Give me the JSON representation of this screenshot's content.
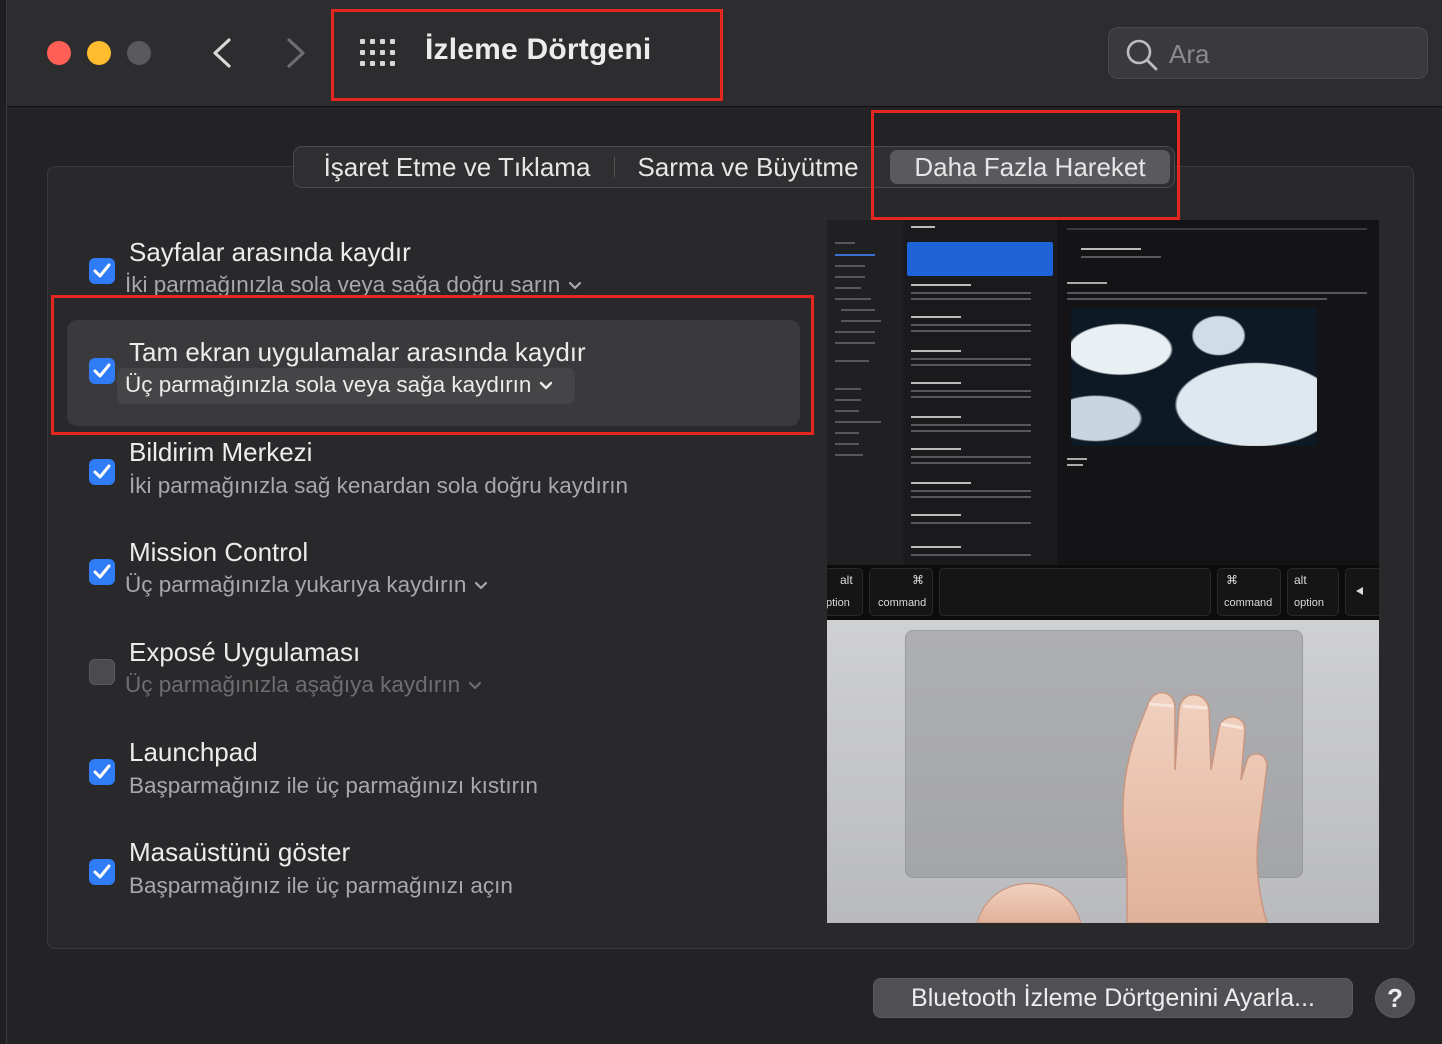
{
  "window": {
    "title": "İzleme Dörtgeni",
    "search_placeholder": "Ara"
  },
  "tabs": [
    {
      "label": "İşaret Etme ve Tıklama",
      "selected": false
    },
    {
      "label": "Sarma ve Büyütme",
      "selected": false
    },
    {
      "label": "Daha Fazla Hareket",
      "selected": true
    }
  ],
  "gestures": [
    {
      "title": "Sayfalar arasında kaydır",
      "subtitle": "İki parmağınızla sola veya sağa doğru sarın",
      "checked": true,
      "has_menu": true
    },
    {
      "title": "Tam ekran uygulamalar arasında kaydır",
      "subtitle": "Üç parmağınızla sola veya sağa kaydırın",
      "checked": true,
      "has_menu": true
    },
    {
      "title": "Bildirim Merkezi",
      "subtitle": "İki parmağınızla sağ kenardan sola doğru kaydırın",
      "checked": true,
      "has_menu": false
    },
    {
      "title": "Mission Control",
      "subtitle": "Üç parmağınızla yukarıya kaydırın",
      "checked": true,
      "has_menu": true
    },
    {
      "title": "Exposé Uygulaması",
      "subtitle": "Üç parmağınızla aşağıya kaydırın",
      "checked": false,
      "has_menu": true
    },
    {
      "title": "Launchpad",
      "subtitle": "Başparmağınız ile üç parmağınızı kıstırın",
      "checked": true,
      "has_menu": false
    },
    {
      "title": "Masaüstünü göster",
      "subtitle": "Başparmağınız ile üç parmağınızı açın",
      "checked": true,
      "has_menu": false
    }
  ],
  "preview": {
    "keys": {
      "left_option": "ption",
      "left_alt": "alt",
      "left_cmd_symbol": "⌘",
      "left_command": "command",
      "right_cmd_symbol": "⌘",
      "right_command": "command",
      "right_alt": "alt",
      "right_option": "option"
    }
  },
  "footer": {
    "bluetooth_button": "Bluetooth İzleme Dörtgenini Ayarla...",
    "help_label": "?"
  },
  "colors": {
    "accent": "#2f7cf6",
    "annotation": "#e5281f"
  }
}
